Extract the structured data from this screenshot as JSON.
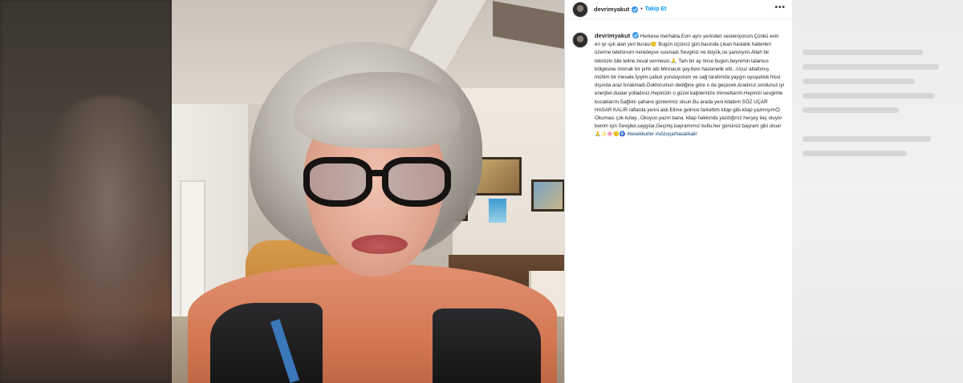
{
  "post": {
    "username": "devrimyakut",
    "follow_label": "Takip Et",
    "header_separator": "•",
    "more_label": "•••",
    "caption_text": "Herkese merhaba.Evin aynı yerinden sesleniyorum.Çünkü evin en iyi ışık alan yeri burası🙂 Bugün üçüncü gün.basında çıkan hastalık haberleri üzerine telefonum neredeyse susmadı.Sevginiz ne büyük,ne şanslıyım.Allah bir tekinizin bile teline zeval vermesin.🙏 Tam bir ay önce bugün.beynimin talamus bölgesine minnak bir pıhtı attı.Minnacık şey.beni hastanelik etti...Ucuz atlattımış mühim bir mesele.İyiyim.çabuk yoruluyorum ve sağ tarafımda yaygın uyuşukluk hissi dışında araz bırakmadı.Doktorumun dediğine göre o da geçecek.Aradınız.sordunuz.iyi enerjiler.dualar yolladınız.Hepinizin o güzel kalplerinize minnettarım.Hepinizi sevgimle kucaklarım.Sağlıklı şahane günlerimiz olsun.Bu arada yeni kitabım SÖZ UÇAR HASAR KALIR raflarda yerini aldı.Elime gelince farkettim kitap gibi kitap yazmışım😊 Okuması çok kolay...Okuyun,yazın bana. kitap hakkında yazdığınız herşey ilaç oluyor benim için.Sevgiler,saygılar.Geçmiş bayramımız kutlu.her gününüz bayram gibi olsun🙏✨🌸🙂🧿",
    "hashtags": "#tesekkurler #sözuçarhasarkalir"
  }
}
